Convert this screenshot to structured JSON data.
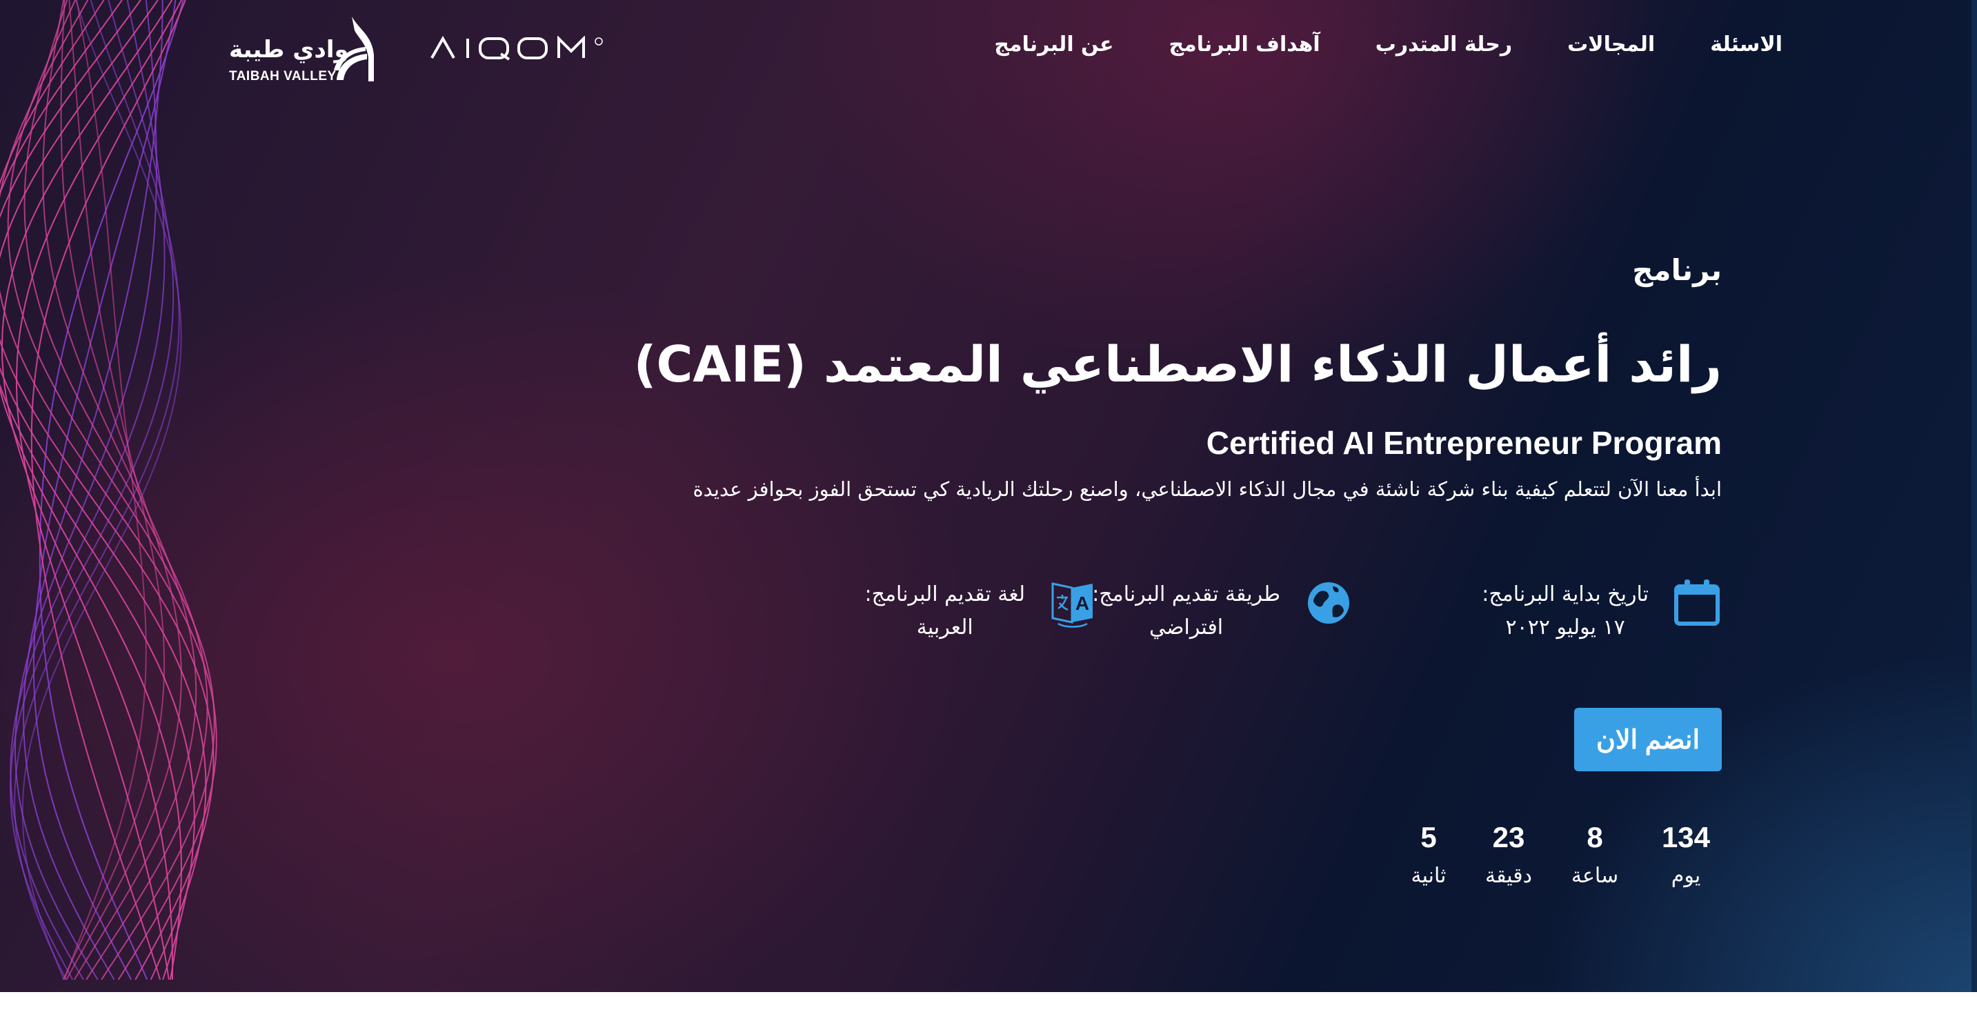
{
  "nav": {
    "items": [
      "عن البرنامج",
      "آهداف البرنامج",
      "رحلة المتدرب",
      "المجالات",
      "الاسئلة"
    ]
  },
  "logos": {
    "taibah_ar": "وادي طيبة",
    "taibah_en": "TAIBAH VALLEY",
    "aiqom": "AIQOM"
  },
  "hero": {
    "kicker": "برنامج",
    "title": "رائد أعمال الذكاء الاصطناعي المعتمد (CAIE)",
    "subtitle": "Certified AI Entrepreneur Program",
    "description": "ابدأ معنا الآن لتتعلم كيفية بناء شركة ناشئة في مجال الذكاء الاصطناعي، واصنع رحلتك الريادية كي تستحق الفوز بحوافز عديدة"
  },
  "info": {
    "start_label": "تاريخ بداية البرنامج:",
    "start_value": "١٧ يوليو ٢٠٢٢",
    "method_label": "طريقة تقديم البرنامج:",
    "method_value": "افتراضي",
    "language_label": "لغة تقديم البرنامج:",
    "language_value": "العربية"
  },
  "cta": {
    "join_label": "انضم الان"
  },
  "countdown": {
    "days": "134",
    "days_label": "يوم",
    "hours": "8",
    "hours_label": "ساعة",
    "minutes": "23",
    "minutes_label": "دقيقة",
    "seconds": "5",
    "seconds_label": "ثانية"
  },
  "colors": {
    "accent": "#3aa0e6",
    "wave_pink": "#d8449a",
    "wave_purple": "#8a3fd0"
  },
  "icons": {
    "start": "calendar-icon",
    "method": "globe-icon",
    "language": "translate-icon"
  }
}
